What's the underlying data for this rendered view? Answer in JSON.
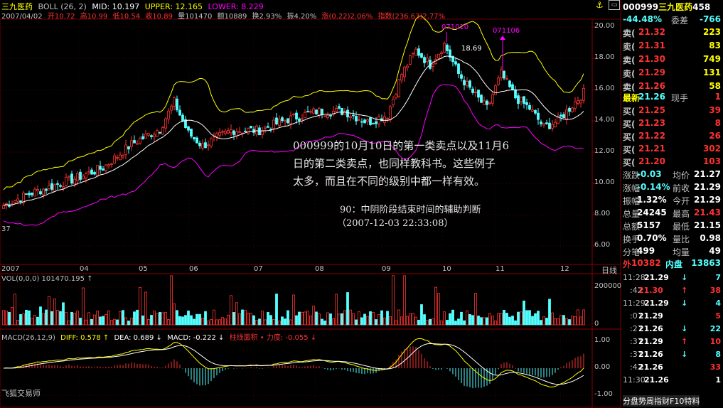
{
  "header": {
    "stock_name": "三九医药",
    "indicator": "BOLL (26, 2)",
    "mid": "MID: 10.197",
    "upper": "UPPER: 12.165",
    "lower": "LOWER: 8.229",
    "date": "2007/04/02",
    "open": "开10.72",
    "high": "高10.99",
    "low": "低10.54",
    "close": "收10.89",
    "volume": "量101470",
    "amount": "额10889",
    "turnover": "换2.93%",
    "amplitude": "振4.20%",
    "change": "涨(0.22)2.06%",
    "index": "指数(236.63)2.77%"
  },
  "chart_labels": {
    "peak1_date": "071010",
    "peak2_date": "071106",
    "peak_price": "18.69",
    "low_mark": "37",
    "x_months": [
      "2007",
      "04",
      "05",
      "06",
      "07",
      "08",
      "09",
      "10",
      "11",
      "12"
    ],
    "period": "日线",
    "y_price": [
      "20.00",
      "18.00",
      "16.00",
      "14.00",
      "12.00",
      "10.00",
      "8.00",
      "6.00"
    ],
    "vol_header": "VOL(0,0,0)  101470.195 ↑",
    "y_vol": [
      "200000",
      "0"
    ],
    "macd_header_main": "MACD(26,12,9)",
    "diff": "DIFF: 0.578 ↑",
    "dea": "DEA: 0.689 ↓",
    "macd": "MACD: -0.222 ↓",
    "bar_label": "柱线面积 • 力度: -0.055 ↓",
    "y_macd": [
      "1.00",
      "0.00",
      "-1.00"
    ],
    "brand": "飞狐交易师"
  },
  "annotation": {
    "line1": "000999的10月10日的第一类卖点以及11月6",
    "line2": "日的第二类卖点，也同样教科书。这些例子",
    "line3": "太多，而且在不同的级别中都一样有效。",
    "title": "90：中阴阶段结束时间的辅助判断",
    "time": "（2007-12-03 22:33:08）"
  },
  "right_panel": {
    "code": "000999",
    "name": "三九医药",
    "code_tail": "458",
    "ratio": "-44.48%",
    "ratio_label": "委差",
    "diff_value": "-766",
    "asks": [
      {
        "label": "卖",
        "price": "21.32",
        "vol": "223"
      },
      {
        "label": "卖",
        "price": "21.31",
        "vol": "83"
      },
      {
        "label": "卖",
        "price": "21.30",
        "vol": "749"
      },
      {
        "label": "卖",
        "price": "21.29",
        "vol": "131"
      },
      {
        "label": "卖",
        "price": "21.26",
        "vol": "58"
      }
    ],
    "last_label": "最新",
    "last_price": "21.26",
    "now_label": "现手",
    "now_vol": "1",
    "bids": [
      {
        "label": "买",
        "price": "21.25",
        "vol": "39"
      },
      {
        "label": "买",
        "price": "21.23",
        "vol": "8"
      },
      {
        "label": "买",
        "price": "21.22",
        "vol": "26"
      },
      {
        "label": "买",
        "price": "21.21",
        "vol": "302"
      },
      {
        "label": "买",
        "price": "21.20",
        "vol": "103"
      }
    ],
    "stats": [
      {
        "l1": "涨跌",
        "v1": "-0.03",
        "l2": "均价",
        "v2": "21.27"
      },
      {
        "l1": "涨幅",
        "v1": "-0.14%",
        "l2": "前收",
        "v2": "21.29"
      },
      {
        "l1": "振幅",
        "v1": "1.32%",
        "l2": "今开",
        "v2": "21.29"
      },
      {
        "l1": "总量",
        "v1": "24245",
        "l2": "最高",
        "v2": "21.43"
      },
      {
        "l1": "总额",
        "v1": "5157",
        "l2": "最低",
        "v2": "21.15"
      },
      {
        "l1": "换手",
        "v1": "0.70%",
        "l2": "量比",
        "v2": "0.98"
      },
      {
        "l1": "分笔",
        "v1": "499",
        "l2": "均量",
        "v2": "49"
      }
    ],
    "outer_label": "外",
    "outer": "10382",
    "inner_label": "内盘",
    "inner": "13863",
    "ticks": [
      {
        "time": "11:28",
        "price": "21.29",
        "vol": "7"
      },
      {
        "time": ":42",
        "price": "21.30",
        "vol": "38"
      },
      {
        "time": "11:29",
        "price": "21.29",
        "vol": "4"
      },
      {
        "time": ":07",
        "price": "21.29",
        "vol": "5"
      },
      {
        "time": ":27",
        "price": "21.26",
        "vol": "22"
      },
      {
        "time": ":37",
        "price": "21.29",
        "vol": "10"
      },
      {
        "time": ":37",
        "price": "21.26",
        "vol": "8"
      },
      {
        "time": ":42",
        "price": "21.26",
        "vol": "33"
      },
      {
        "time": "11:30",
        "price": "21.26",
        "vol": "1"
      }
    ],
    "bottom": "分盘势周指财F10特料"
  },
  "colors": {
    "up": "#ff3232",
    "down": "#54ffff",
    "mid": "#ffffff",
    "upper": "#ffff00",
    "lower": "#ff00ff",
    "grid": "#8b0000"
  }
}
